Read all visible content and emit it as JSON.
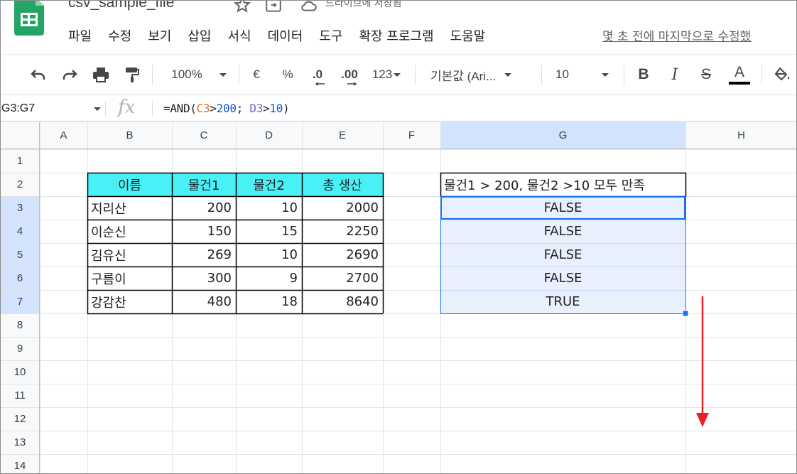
{
  "app": {
    "doc_title": "csv_sample_file",
    "save_status": "드라이브에 저장됨",
    "menu": [
      "파일",
      "수정",
      "보기",
      "삽입",
      "서식",
      "데이터",
      "도구",
      "확장 프로그램",
      "도움말"
    ],
    "last_edit": "몇 초 전에 마지막으로 수정했"
  },
  "toolbar": {
    "zoom": "100%",
    "currency": "€",
    "percent": "%",
    "decimal_decrease": ".0",
    "decimal_increase": ".00",
    "number_format": "123",
    "font": "기본값 (Ari...",
    "font_size": "10",
    "bold": "B",
    "italic": "I",
    "strike": "S",
    "text_color": "A"
  },
  "formula_bar": {
    "name_box": "G3:G7",
    "fx": "fx",
    "formula_parts": {
      "prefix": "=AND(",
      "ref1": "C3",
      "op1": ">",
      "num1": "200",
      "sep": "; ",
      "ref2": "D3",
      "op2": ">",
      "num2": "10",
      "suffix": ")"
    }
  },
  "grid": {
    "columns": [
      "A",
      "B",
      "C",
      "D",
      "E",
      "F",
      "G",
      "H"
    ],
    "rows": [
      "1",
      "2",
      "3",
      "4",
      "5",
      "6",
      "7",
      "8",
      "9",
      "10",
      "11",
      "12",
      "13",
      "14"
    ],
    "selected_column": "G",
    "selected_rows": [
      "3",
      "4",
      "5",
      "6",
      "7"
    ],
    "table": {
      "headers": [
        "이름",
        "물건1",
        "물건2",
        "총 생산"
      ],
      "rows": [
        [
          "지리산",
          "200",
          "10",
          "2000"
        ],
        [
          "이순신",
          "150",
          "15",
          "2250"
        ],
        [
          "김유신",
          "269",
          "10",
          "2690"
        ],
        [
          "구름이",
          "300",
          "9",
          "2700"
        ],
        [
          "강감찬",
          "480",
          "18",
          "8640"
        ]
      ]
    },
    "result": {
      "header": "물건1 > 200, 물건2 >10 모두 만족",
      "values": [
        "FALSE",
        "FALSE",
        "FALSE",
        "FALSE",
        "TRUE"
      ]
    }
  },
  "colors": {
    "header_fill": "#49f1f7",
    "selection_fill": "#e8f0fe",
    "selection_border": "#1a73e8",
    "arrow": "#e8202a"
  }
}
